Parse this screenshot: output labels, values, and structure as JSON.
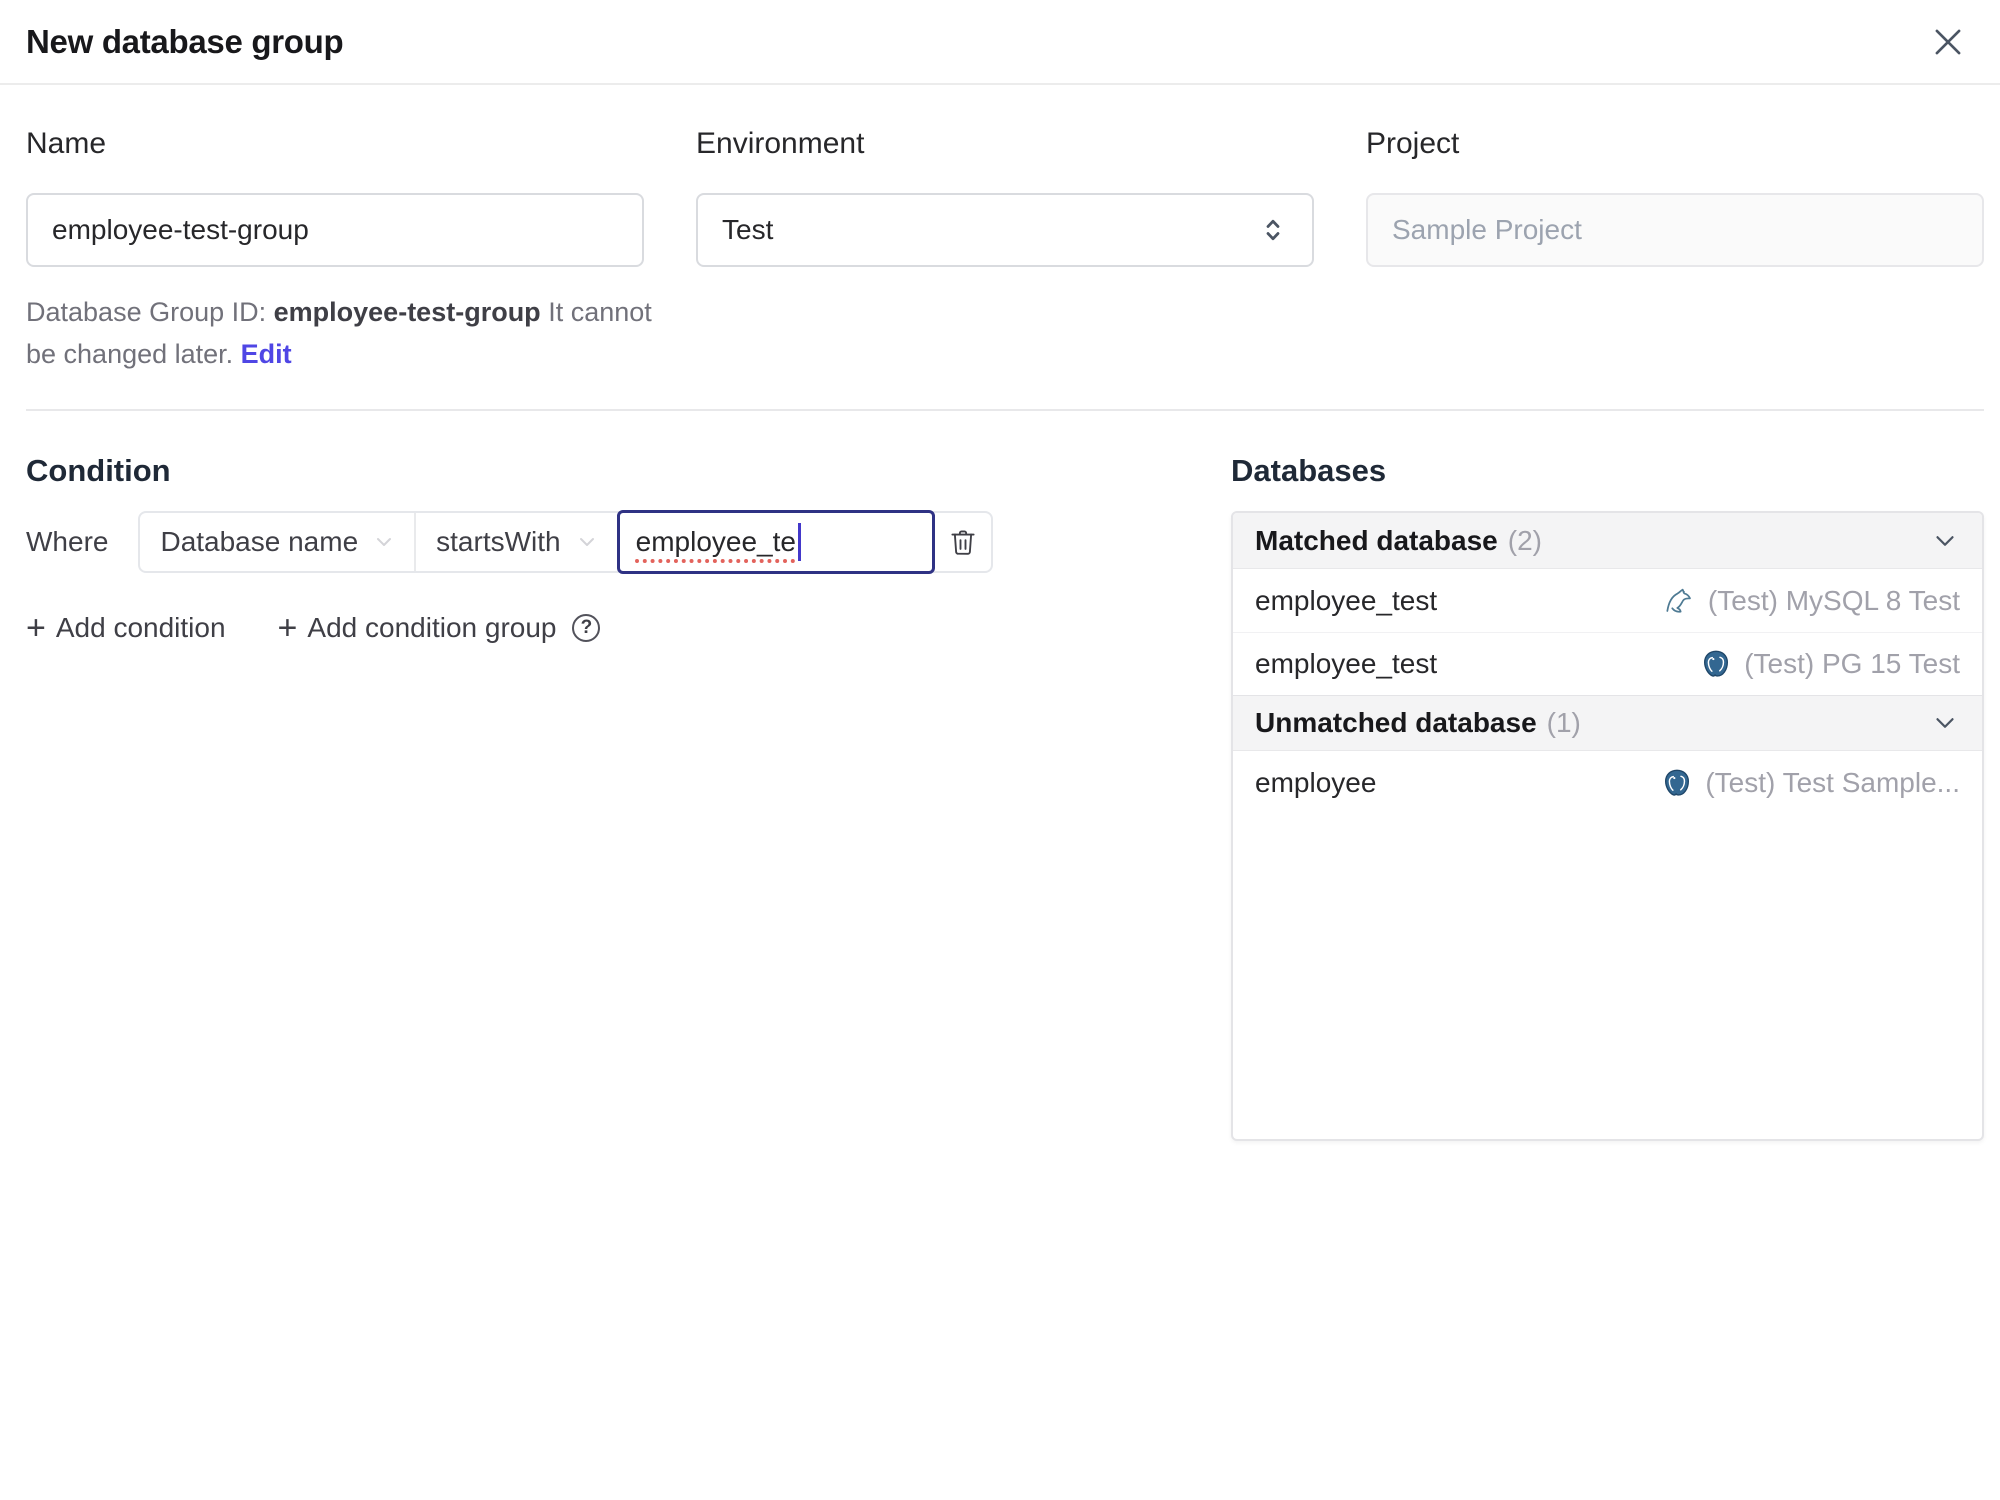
{
  "colors": {
    "accent": "#4f46e5",
    "focus_border": "#2f3284",
    "spellcheck_underline": "#e3635c",
    "mysql_icon": "#4e7a93",
    "postgres_icon": "#336791"
  },
  "dialog": {
    "title": "New database group"
  },
  "form": {
    "name": {
      "label": "Name",
      "value": "employee-test-group"
    },
    "environment": {
      "label": "Environment",
      "value": "Test"
    },
    "project": {
      "label": "Project",
      "value": "Sample Project"
    },
    "group_id_hint": {
      "prefix": "Database Group ID: ",
      "id": "employee-test-group",
      "suffix": " It cannot be changed later. ",
      "edit_label": "Edit"
    }
  },
  "condition": {
    "heading": "Condition",
    "where_label": "Where",
    "field_selected": "Database name",
    "operator_selected": "startsWith",
    "value": "employee_te",
    "plus_icon": "+",
    "add_condition_label": "Add condition",
    "add_condition_group_label": "Add condition group",
    "help_icon": "?"
  },
  "databases": {
    "heading": "Databases",
    "sections": [
      {
        "title": "Matched database",
        "count": "(2)",
        "rows": [
          {
            "name": "employee_test",
            "engine_icon": "mysql-icon",
            "instance": "(Test) MySQL 8 Test"
          },
          {
            "name": "employee_test",
            "engine_icon": "postgres-icon",
            "instance": "(Test) PG 15 Test"
          }
        ]
      },
      {
        "title": "Unmatched database",
        "count": "(1)",
        "rows": [
          {
            "name": "employee",
            "engine_icon": "postgres-icon",
            "instance": "(Test) Test Sample..."
          }
        ]
      }
    ]
  }
}
